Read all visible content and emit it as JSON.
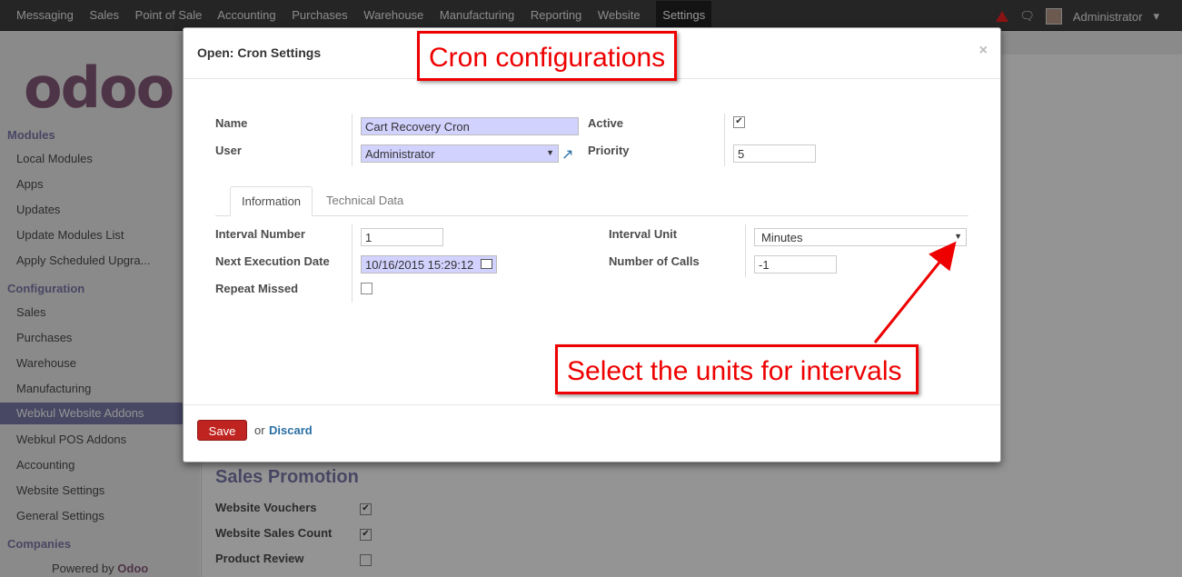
{
  "topbar": {
    "menu": [
      "Messaging",
      "Sales",
      "Point of Sale",
      "Accounting",
      "Purchases",
      "Warehouse",
      "Manufacturing",
      "Reporting",
      "Website",
      "Settings"
    ],
    "active": "Settings",
    "user": "Administrator"
  },
  "logo": "odoo",
  "sidebar": {
    "modules_header": "Modules",
    "modules": [
      "Local Modules",
      "Apps",
      "Updates",
      "Update Modules List",
      "Apply Scheduled Upgra..."
    ],
    "config_header": "Configuration",
    "config": [
      "Sales",
      "Purchases",
      "Warehouse",
      "Manufacturing",
      "Webkul Website Addons",
      "Webkul POS Addons",
      "Accounting",
      "Website Settings",
      "General Settings"
    ],
    "companies_header": "Companies",
    "powered_prefix": "Powered by",
    "powered_brand": "Odoo"
  },
  "background": {
    "section_title": "Sales Promotion",
    "rows": [
      {
        "label": "Website Vouchers",
        "checked": true
      },
      {
        "label": "Website Sales Count",
        "checked": true
      },
      {
        "label": "Product Review",
        "checked": false
      }
    ]
  },
  "modal": {
    "title": "Open: Cron Settings",
    "close": "×",
    "name_label": "Name",
    "name_value": "Cart Recovery Cron",
    "user_label": "User",
    "user_value": "Administrator",
    "active_label": "Active",
    "active_checked": true,
    "priority_label": "Priority",
    "priority_value": "5",
    "tabs": [
      "Information",
      "Technical Data"
    ],
    "interval_number_label": "Interval Number",
    "interval_number_value": "1",
    "next_exec_label": "Next Execution Date",
    "next_exec_value": "10/16/2015 15:29:12",
    "repeat_missed_label": "Repeat Missed",
    "repeat_missed_checked": false,
    "interval_unit_label": "Interval Unit",
    "interval_unit_value": "Minutes",
    "number_calls_label": "Number of Calls",
    "number_calls_value": "-1",
    "save_label": "Save",
    "or_text": "or",
    "discard_label": "Discard"
  },
  "annotations": {
    "title_callout": "Cron configurations",
    "unit_callout": "Select the units for intervals",
    "color": "#e00000"
  }
}
